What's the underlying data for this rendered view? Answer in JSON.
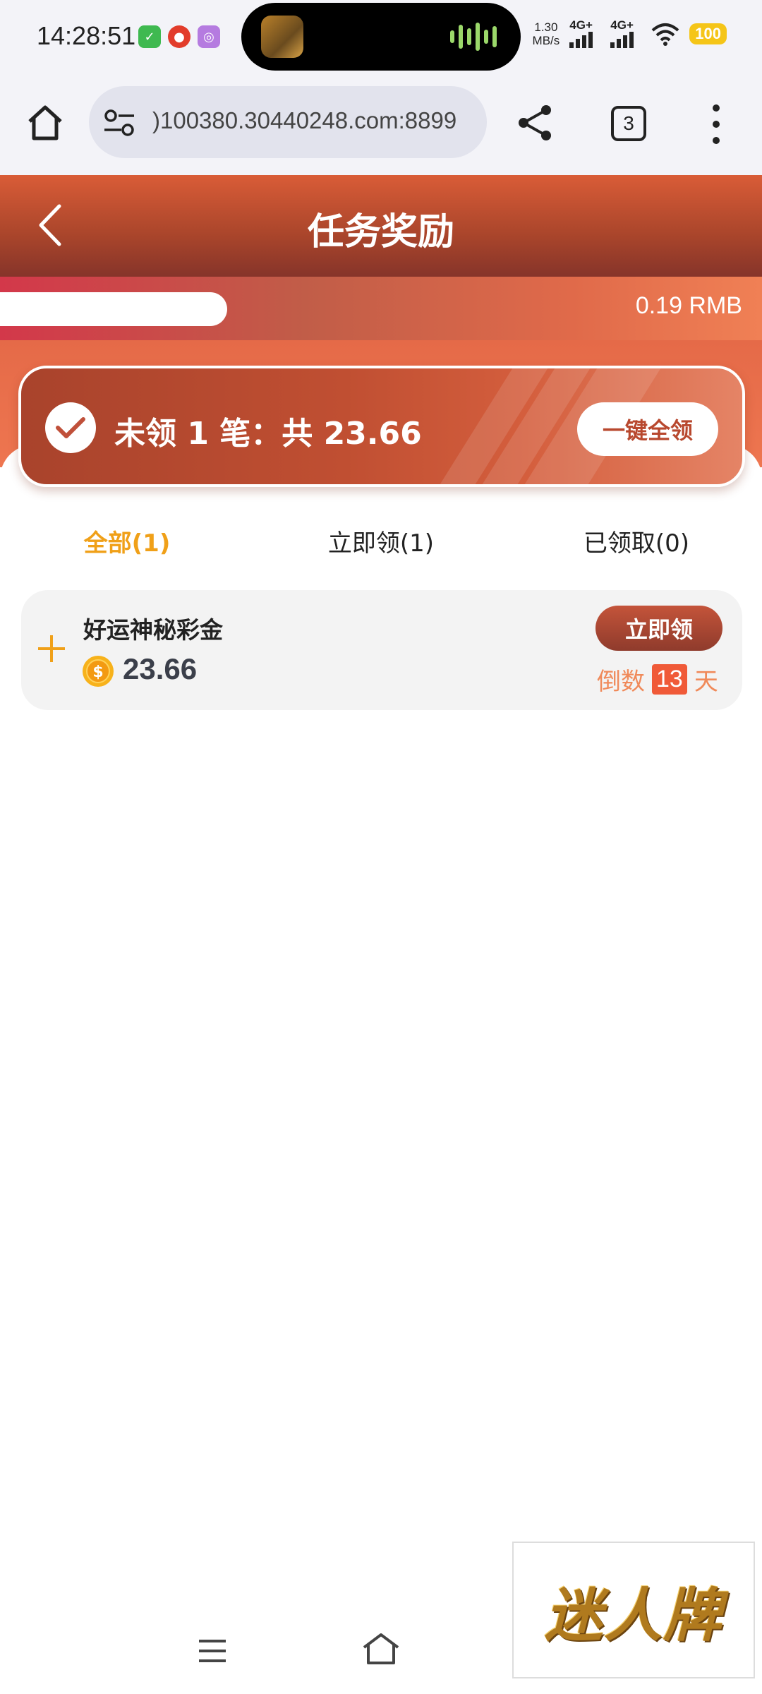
{
  "status_bar": {
    "time": "14:28:51",
    "net_speed_value": "1.30",
    "net_speed_unit": "MB/s",
    "sim1_tag": "4G+",
    "sim2_tag": "4G+",
    "battery": "100",
    "notification_icons": [
      "wechat-icon",
      "app-mascot-icon",
      "purple-app-icon"
    ]
  },
  "browser": {
    "url": ")100380.30440248.com:8899",
    "tab_count": "3"
  },
  "header": {
    "title": "任务奖励",
    "balance": "0.19 RMB"
  },
  "summary": {
    "text": "未领 1 笔：共 23.66",
    "claim_all_label": "一键全领"
  },
  "tabs": [
    {
      "label": "全部(1)",
      "active": true
    },
    {
      "label": "立即领(1)",
      "active": false
    },
    {
      "label": "已领取(0)",
      "active": false
    }
  ],
  "reward_items": [
    {
      "name": "好运神秘彩金",
      "amount": "23.66",
      "claim_label": "立即领",
      "countdown_prefix": "倒数",
      "countdown_value": "13",
      "countdown_unit": "天"
    }
  ],
  "watermark": {
    "text": "迷人牌"
  },
  "colors": {
    "accent": "#f0a018",
    "header_red": "#c04f32",
    "countdown": "#f08a5a",
    "countdown_badge": "#f05a38"
  }
}
